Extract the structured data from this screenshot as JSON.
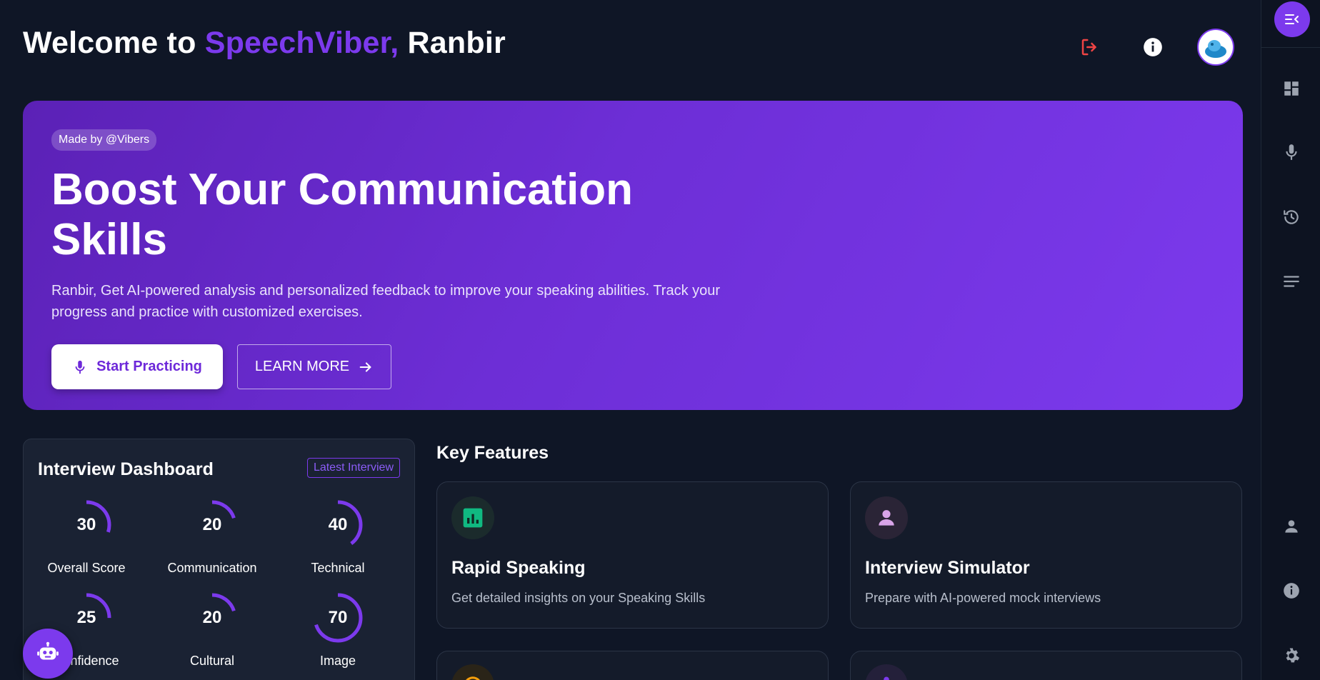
{
  "header": {
    "welcome_prefix": "Welcome to",
    "brand": "SpeechViber,",
    "user_name": "Ranbir",
    "logout_icon": "logout-icon",
    "info_icon": "info-icon",
    "avatar_icon": "avatar"
  },
  "hero": {
    "badge": "Made by @Vibers",
    "title_line1": "Boost Your Communication",
    "title_line2": "Skills",
    "description": "Ranbir, Get AI-powered analysis and personalized feedback to improve your speaking abilities. Track your progress and practice with customized exercises.",
    "start_button": "Start Practicing",
    "learn_button": "LEARN MORE"
  },
  "dashboard": {
    "title": "Interview Dashboard",
    "tag": "Latest Interview",
    "metrics": [
      {
        "label": "Overall Score",
        "value": 30
      },
      {
        "label": "Communication",
        "value": 20
      },
      {
        "label": "Technical",
        "value": 40
      },
      {
        "label": "Confidence",
        "value": 25
      },
      {
        "label": "Cultural",
        "value": 20
      },
      {
        "label": "Image",
        "value": 70
      }
    ]
  },
  "features": {
    "title": "Key Features",
    "cards": [
      {
        "title": "Rapid Speaking",
        "description": "Get detailed insights on your Speaking Skills",
        "icon": "bar-chart-icon"
      },
      {
        "title": "Interview Simulator",
        "description": "Prepare with AI-powered mock interviews",
        "icon": "person-icon"
      }
    ]
  },
  "rail": {
    "items": [
      "menu-collapse-icon",
      "dashboard-icon",
      "microphone-icon",
      "history-icon",
      "list-icon",
      "profile-icon",
      "info-icon",
      "settings-icon"
    ]
  },
  "colors": {
    "background": "#0f1626",
    "accent": "#7c3aed",
    "logout": "#ef4444",
    "feature_green": "#10b981",
    "feature_pink": "#d8a4e8"
  }
}
